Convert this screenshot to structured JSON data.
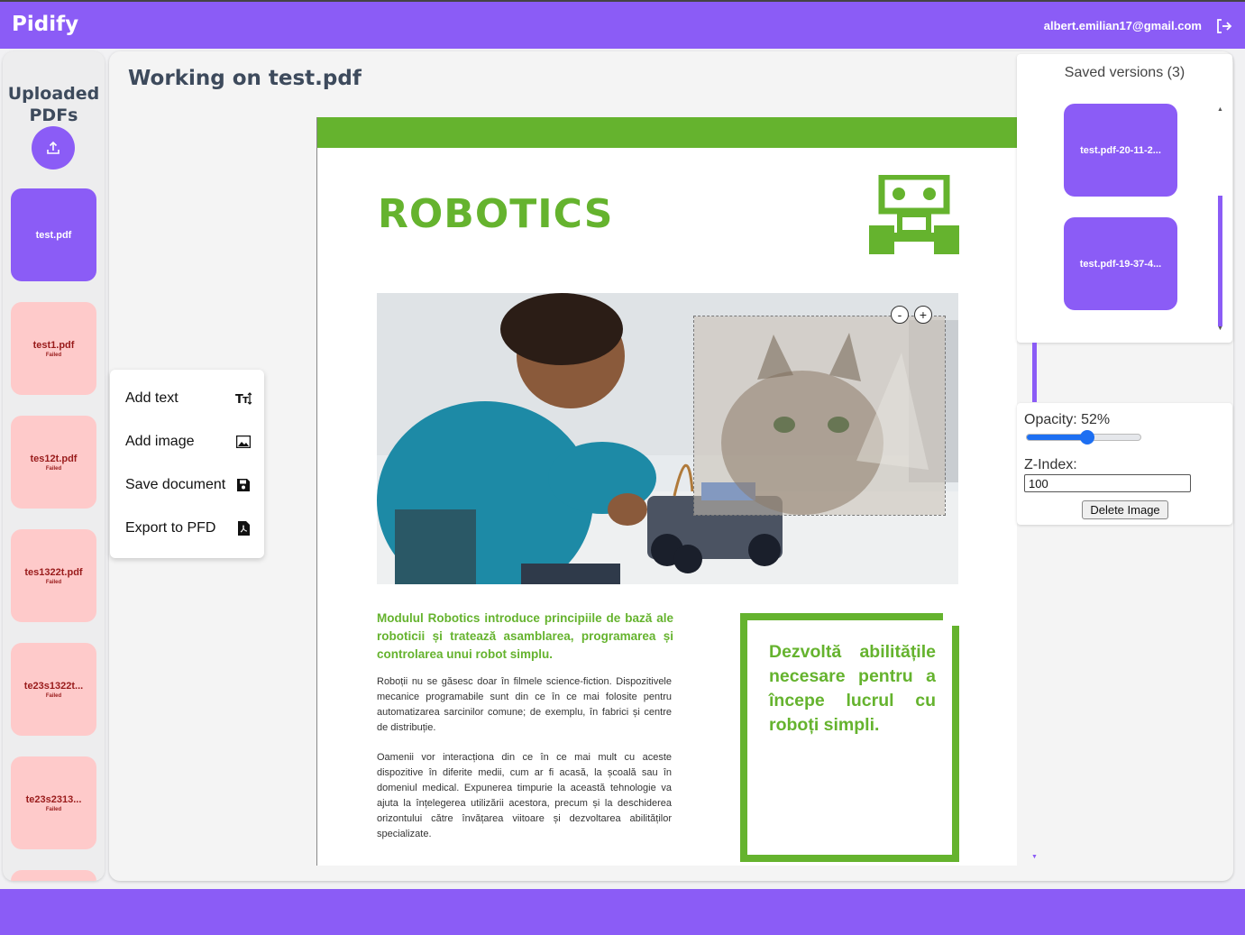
{
  "app": {
    "name": "Pidify",
    "user_email": "albert.emilian17@gmail.com"
  },
  "sidebar": {
    "title": "Uploaded PDFs",
    "files": [
      {
        "name": "test.pdf",
        "status": ""
      },
      {
        "name": "test1.pdf",
        "status": "Failed"
      },
      {
        "name": "tes12t.pdf",
        "status": "Failed"
      },
      {
        "name": "tes1322t.pdf",
        "status": "Failed"
      },
      {
        "name": "te23s1322t...",
        "status": "Failed"
      },
      {
        "name": "te23s2313...",
        "status": "Failed"
      }
    ]
  },
  "main": {
    "title": "Working on test.pdf"
  },
  "toolmenu": {
    "add_text": "Add text",
    "add_image": "Add image",
    "save_document": "Save document",
    "export": "Export to PFD"
  },
  "document": {
    "heading": "ROBOTICS",
    "lead": "Modulul Robotics introduce principiile de bază ale roboticii și tratează asamblarea, programarea și controlarea unui robot simplu.",
    "paragraph1": "Roboții nu se găsesc doar în filmele science-fiction. Dispozitivele mecanice programabile sunt din ce în ce mai folosite pentru automatizarea sarcinilor comune; de exemplu, în fabrici și centre de distribuție.",
    "paragraph2": "Oamenii vor interacționa din ce în ce mai mult cu aceste dispozitive în diferite medii, cum ar fi acasă, la școală sau în domeniul medical. Expunerea timpurie la această tehnologie va ajuta la înțelegerea utilizării acestora, precum și la deschiderea orizontului către învățarea viitoare și dezvoltarea abilităților specializate.",
    "callout": "Dezvoltă abilitățile necesare pentru a începe lucrul cu roboți simpli.",
    "zoom_out": "-",
    "zoom_in": "+"
  },
  "versions": {
    "title": "Saved versions (3)",
    "items": [
      "test.pdf-20-11-2...",
      "test.pdf-19-37-4..."
    ]
  },
  "properties": {
    "opacity_label": "Opacity: 52%",
    "opacity_value": 0.52,
    "zindex_label": "Z-Index:",
    "zindex_value": "100",
    "delete_label": "Delete Image"
  },
  "colors": {
    "accent": "#8b5cf6",
    "doc_green": "#65b32e",
    "failed_bg": "#fecaca",
    "failed_text": "#991b1b"
  }
}
